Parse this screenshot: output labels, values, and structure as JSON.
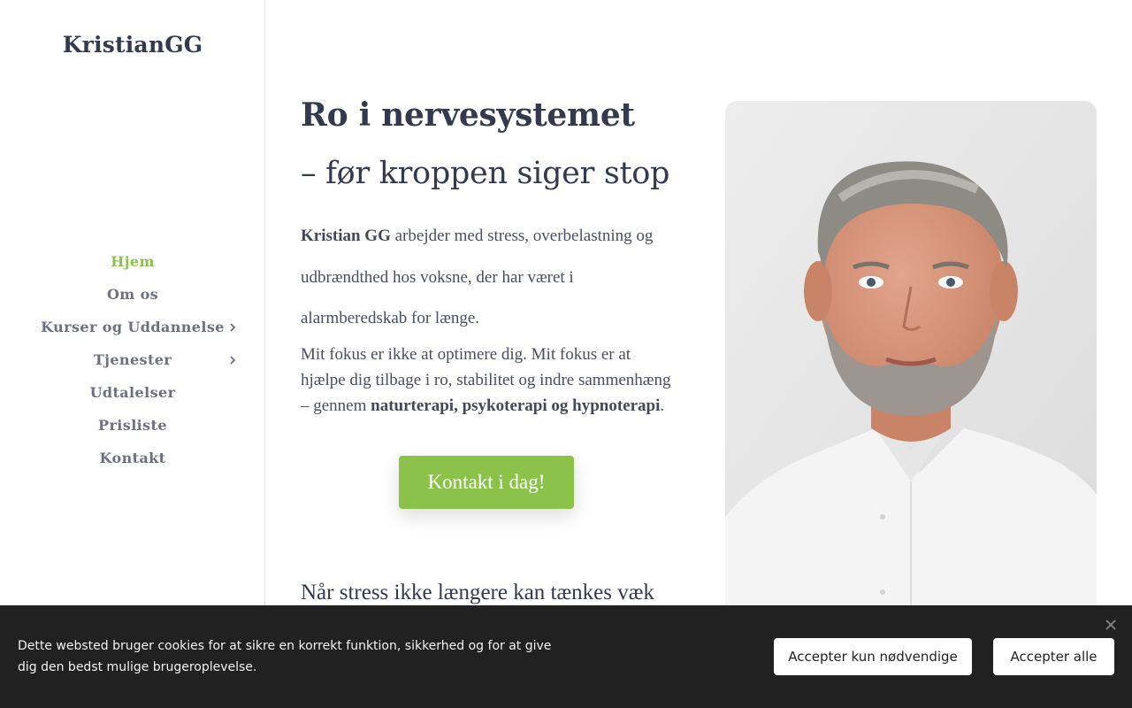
{
  "site": {
    "logo": "KristianGG"
  },
  "nav": {
    "items": [
      {
        "label": "Hjem",
        "active": true,
        "has_submenu": false
      },
      {
        "label": "Om os",
        "active": false,
        "has_submenu": false
      },
      {
        "label": "Kurser og Uddannelse",
        "active": false,
        "has_submenu": true
      },
      {
        "label": "Tjenester",
        "active": false,
        "has_submenu": true
      },
      {
        "label": "Udtalelser",
        "active": false,
        "has_submenu": false
      },
      {
        "label": "Prisliste",
        "active": false,
        "has_submenu": false
      },
      {
        "label": "Kontakt",
        "active": false,
        "has_submenu": false
      }
    ],
    "submenu_icon": "chevron-right-icon"
  },
  "hero": {
    "title": "Ro i nervesystemet",
    "subtitle": "– før kroppen siger stop",
    "intro_name": "Kristian GG",
    "intro_rest": " arbejder med stress, overbelastning og udbrændthed hos voksne, der har været i alarmberedskab for længe.",
    "focus_text": "Mit fokus er ikke at optimere dig. Mit fokus er at hjælpe dig tilbage i ro, stabilitet og indre sammenhæng – gennem ",
    "focus_strong": "naturterapi, psykoterapi og hypnoterapi",
    "focus_end": ".",
    "cta_label": "Kontakt i dag!",
    "section_heading": "Når stress ikke længere kan tænkes væk"
  },
  "cookie_banner": {
    "text": "Dette websted bruger cookies for at sikre en korrekt funktion, sikkerhed og for at give dig den bedst mulige brugeroplevelse.",
    "necessary_label": "Accepter kun nødvendige",
    "accept_all_label": "Accepter alle",
    "close_icon": "close-icon"
  },
  "colors": {
    "accent": "#8bc34a",
    "heading": "#343a4e",
    "cookie_bg": "#212121"
  }
}
